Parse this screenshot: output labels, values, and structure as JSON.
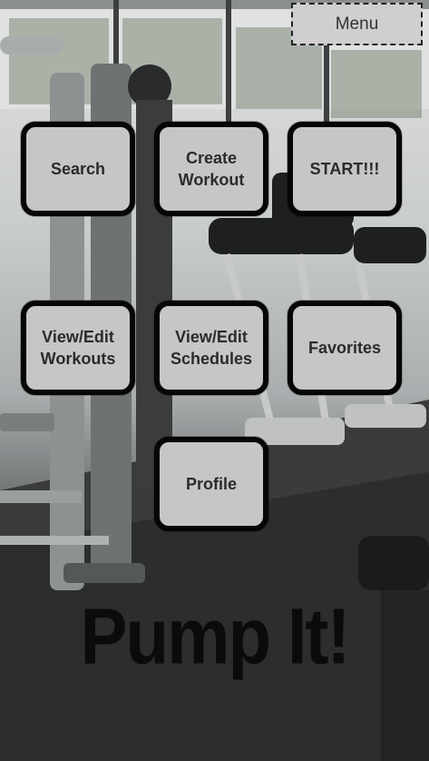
{
  "menu": {
    "label": "Menu"
  },
  "tiles": {
    "search": "Search",
    "create_workout": "Create\nWorkout",
    "start": "START!!!",
    "view_edit_workouts": "View/Edit\nWorkouts",
    "view_edit_schedules": "View/Edit\nSchedules",
    "favorites": "Favorites",
    "profile": "Profile"
  },
  "title": "Pump It!",
  "background": {
    "icon": "gym-background-image"
  }
}
